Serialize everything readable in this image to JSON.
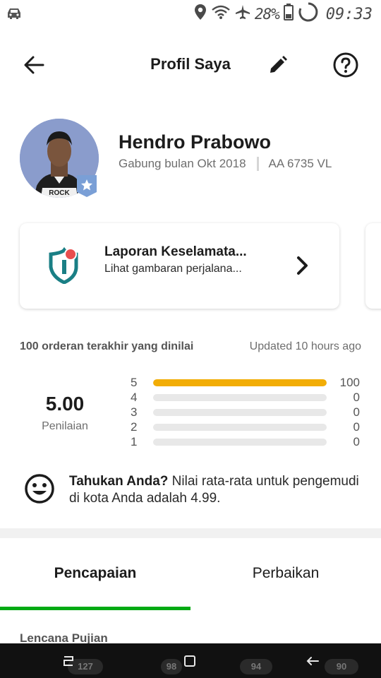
{
  "status_bar": {
    "battery_percent": "28%",
    "time": "09:33",
    "icons": [
      "car-icon",
      "location-icon",
      "wifi-icon",
      "airplane-icon",
      "battery-icon",
      "sync-icon"
    ]
  },
  "header": {
    "title": "Profil Saya",
    "icons": [
      "back-arrow-icon",
      "pencil-icon",
      "help-icon"
    ]
  },
  "profile": {
    "name": "Hendro Prabowo",
    "joined": "Gabung bulan Okt 2018",
    "plate": "AA 6735 VL",
    "shirt_text": "ROCK",
    "badge_icon": "star-badge-icon"
  },
  "safety_card": {
    "title": "Laporan Keselamata...",
    "subtitle": "Lihat gambaran perjalana...",
    "icon": "shield-icon",
    "colors": {
      "shield": "#1a7f85",
      "dot": "#e84e4e"
    }
  },
  "ratings": {
    "header_left": "100 orderan terakhir yang dinilai",
    "header_right": "Updated 10 hours ago",
    "score": "5.00",
    "score_label": "Penilaian",
    "bars": [
      {
        "star": "5",
        "count": "100",
        "fraction": 1.0
      },
      {
        "star": "4",
        "count": "0",
        "fraction": 0.0
      },
      {
        "star": "3",
        "count": "0",
        "fraction": 0.0
      },
      {
        "star": "2",
        "count": "0",
        "fraction": 0.0
      },
      {
        "star": "1",
        "count": "0",
        "fraction": 0.0
      }
    ],
    "bar_color": "#f2ad06"
  },
  "did_you_know": {
    "lead": "Tahukan Anda?",
    "text": " Nilai rata-rata untuk pengemudi di kota Anda adalah 4.99.",
    "icon": "smiley-icon"
  },
  "tabs": [
    {
      "label": "Pencapaian",
      "active": true
    },
    {
      "label": "Perbaikan",
      "active": false
    }
  ],
  "accent_color": "#00aa13",
  "section": {
    "label": "Lencana Pujian"
  },
  "badge_counts": [
    "127",
    "98",
    "94",
    "90"
  ],
  "nav_bar": {
    "icons": [
      "recent-apps-icon",
      "home-icon",
      "back-icon"
    ]
  }
}
